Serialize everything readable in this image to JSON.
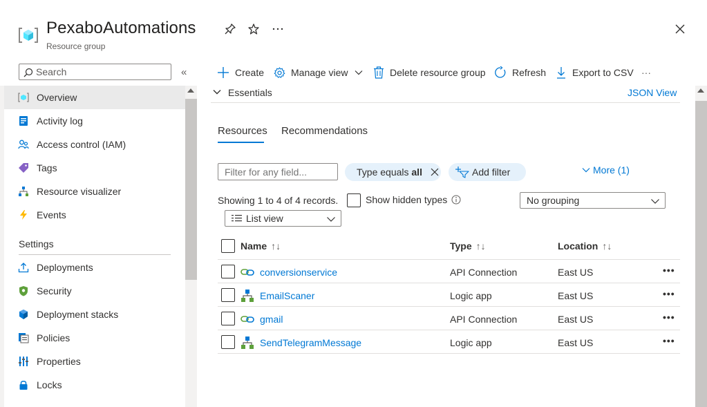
{
  "header": {
    "title": "PexaboAutomations",
    "subtitle": "Resource group",
    "pin_icon": "pin-icon",
    "star_icon": "star-icon",
    "more_icon": "ellipsis-icon",
    "close_icon": "close-icon"
  },
  "sidebar": {
    "search_placeholder": "Search",
    "collapse_label": "«",
    "items": [
      {
        "label": "Overview",
        "icon": "resource-group-icon",
        "active": true
      },
      {
        "label": "Activity log",
        "icon": "activity-log-icon"
      },
      {
        "label": "Access control (IAM)",
        "icon": "iam-icon"
      },
      {
        "label": "Tags",
        "icon": "tag-icon"
      },
      {
        "label": "Resource visualizer",
        "icon": "visualizer-icon"
      },
      {
        "label": "Events",
        "icon": "lightning-icon"
      }
    ],
    "settings_header": "Settings",
    "settings_items": [
      {
        "label": "Deployments",
        "icon": "upload-icon"
      },
      {
        "label": "Security",
        "icon": "shield-icon"
      },
      {
        "label": "Deployment stacks",
        "icon": "cube-icon"
      },
      {
        "label": "Policies",
        "icon": "policy-icon"
      },
      {
        "label": "Properties",
        "icon": "properties-icon"
      },
      {
        "label": "Locks",
        "icon": "lock-icon"
      }
    ]
  },
  "toolbar": {
    "create": "Create",
    "manage_view": "Manage view",
    "delete": "Delete resource group",
    "refresh": "Refresh",
    "export": "Export to CSV",
    "more": "···"
  },
  "essentials": {
    "label": "Essentials",
    "json_view": "JSON View"
  },
  "tabs": [
    "Resources",
    "Recommendations"
  ],
  "filters": {
    "placeholder": "Filter for any field...",
    "type_filter_prefix": "Type equals ",
    "type_filter_value": "all",
    "add_filter": "Add filter",
    "more": "More (1)"
  },
  "records": {
    "showing": "Showing 1 to 4 of 4 records.",
    "show_hidden": "Show hidden types",
    "grouping": "No grouping",
    "view": "List view"
  },
  "table": {
    "headers": {
      "name": "Name",
      "type": "Type",
      "location": "Location",
      "sort": "↑↓"
    },
    "rows": [
      {
        "name": "conversionservice",
        "type": "API Connection",
        "location": "East US",
        "icon": "api-connection-icon"
      },
      {
        "name": "EmailScaner",
        "type": "Logic app",
        "location": "East US",
        "icon": "logic-app-icon"
      },
      {
        "name": "gmail",
        "type": "API Connection",
        "location": "East US",
        "icon": "api-connection-icon"
      },
      {
        "name": "SendTelegramMessage",
        "type": "Logic app",
        "location": "East US",
        "icon": "logic-app-icon"
      }
    ],
    "row_more": "•••"
  },
  "colors": {
    "accent": "#0078d4",
    "pill_bg": "#e5f1fb",
    "nav_active": "#eaeaea"
  }
}
